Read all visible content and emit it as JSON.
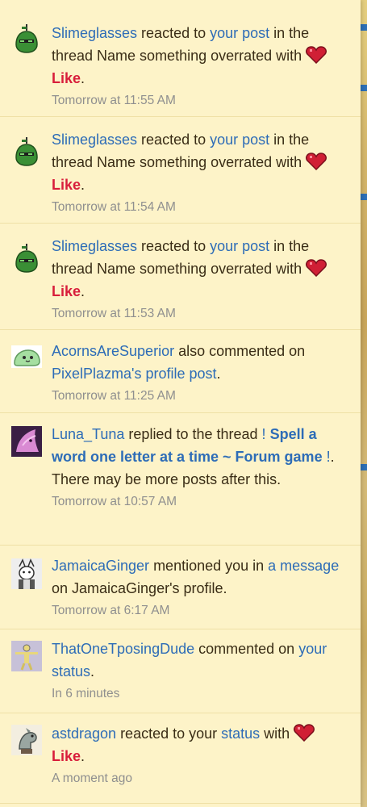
{
  "alerts": [
    {
      "user": "Slimeglasses",
      "action1": " reacted to ",
      "link1": "your post",
      "action2": " in the thread Name something overrated with ",
      "reaction": "Like",
      "end": ".",
      "time": "Tomorrow at 11:55 AM",
      "avatar_icon": "green-blob-icon"
    },
    {
      "user": "Slimeglasses",
      "action1": " reacted to ",
      "link1": "your post",
      "action2": " in the thread Name something overrated with ",
      "reaction": "Like",
      "end": ".",
      "time": "Tomorrow at 11:54 AM",
      "avatar_icon": "green-blob-icon"
    },
    {
      "user": "Slimeglasses",
      "action1": " reacted to ",
      "link1": "your post",
      "action2": " in the thread Name something overrated with ",
      "reaction": "Like",
      "end": ".",
      "time": "Tomorrow at 11:53 AM",
      "avatar_icon": "green-blob-icon"
    },
    {
      "user": "AcornsAreSuperior",
      "action1": " also commented on ",
      "link1": "PixelPlazma's profile post",
      "end": ".",
      "time": "Tomorrow at 11:25 AM",
      "avatar_icon": "green-slug-icon"
    },
    {
      "user": "Luna_Tuna",
      "action1": " replied to the thread ",
      "prefix": "!",
      "thread": "Spell a word one letter at a time ~ Forum game",
      "suffix": "!",
      "end": ". There may be more posts after this.",
      "time": "Tomorrow at 10:57 AM",
      "avatar_icon": "pink-creature-icon"
    },
    {
      "user": "JamaicaGinger",
      "action1": " mentioned you in ",
      "link1": "a message",
      "action2": " on JamaicaGinger's profile.",
      "time": "Tomorrow at 6:17 AM",
      "avatar_icon": "sketch-portrait-icon"
    },
    {
      "user": "ThatOneTposingDude",
      "action1": " commented on ",
      "link1": "your status",
      "end": ".",
      "time": "In 6 minutes",
      "avatar_icon": "tposing-figure-icon"
    },
    {
      "user": "astdragon",
      "action1": " reacted to your ",
      "link1": "status",
      "action2": " with ",
      "reaction": "Like",
      "end": ".",
      "time": "A moment ago",
      "avatar_icon": "grey-dragon-icon"
    }
  ]
}
